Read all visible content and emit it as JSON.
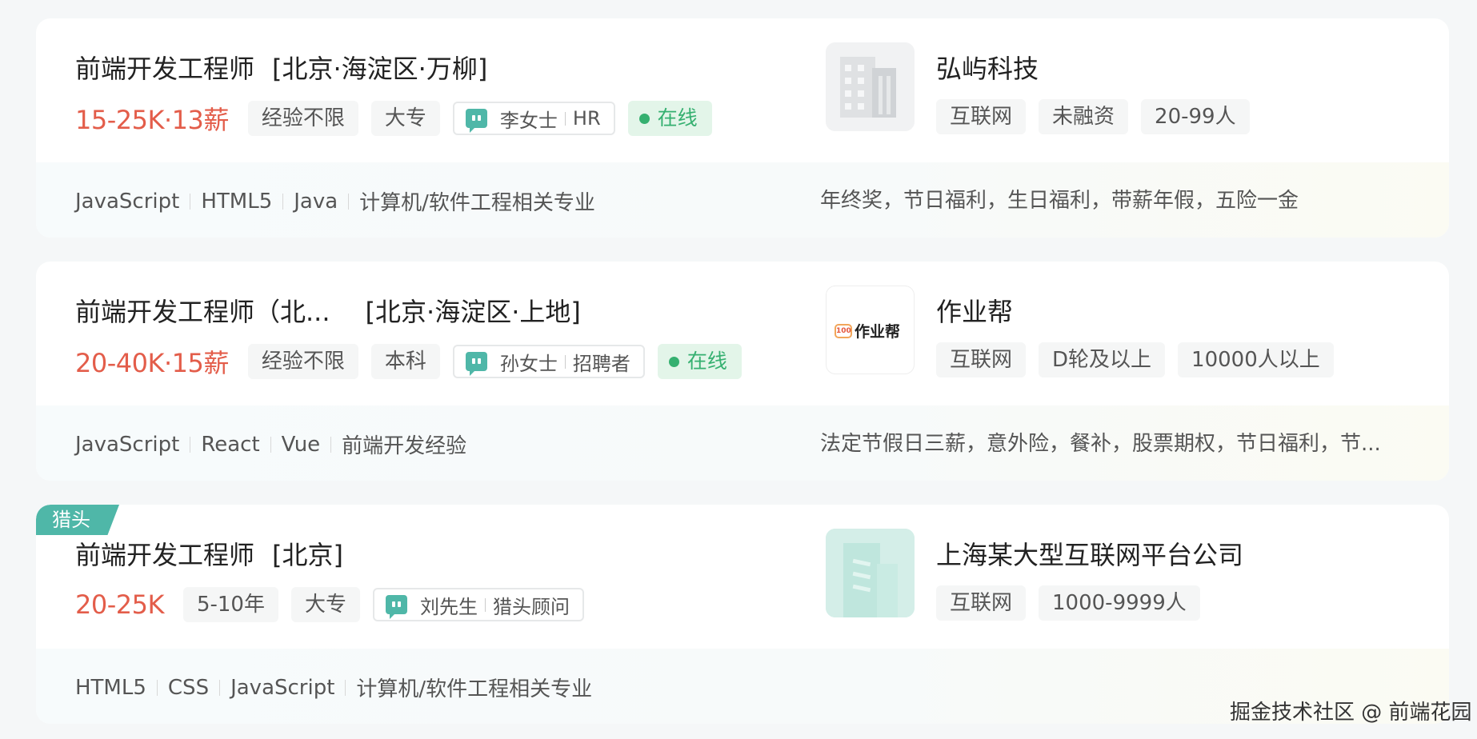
{
  "jobs": [
    {
      "title": "前端开发工程师",
      "location": "[北京·海淀区·万柳]",
      "salary": "15-25K·13薪",
      "tags": [
        "经验不限",
        "大专"
      ],
      "recruiter_name": "李女士",
      "recruiter_role": "HR",
      "online": "在线",
      "skills": [
        "JavaScript",
        "HTML5",
        "Java",
        "计算机/软件工程相关专业"
      ],
      "company": "弘屿科技",
      "company_tags": [
        "互联网",
        "未融资",
        "20-99人"
      ],
      "benefits": "年终奖，节日福利，生日福利，带薪年假，五险一金"
    },
    {
      "title": "前端开发工程师（北...",
      "location": "[北京·海淀区·上地]",
      "salary": "20-40K·15薪",
      "tags": [
        "经验不限",
        "本科"
      ],
      "recruiter_name": "孙女士",
      "recruiter_role": "招聘者",
      "online": "在线",
      "skills": [
        "JavaScript",
        "React",
        "Vue",
        "前端开发经验"
      ],
      "company": "作业帮",
      "company_logo_text": "作业帮",
      "company_logo_badge": "100",
      "company_tags": [
        "互联网",
        "D轮及以上",
        "10000人以上"
      ],
      "benefits": "法定节假日三薪，意外险，餐补，股票期权，节日福利，节..."
    },
    {
      "badge": "猎头",
      "title": "前端开发工程师",
      "location": "[北京]",
      "salary": "20-25K",
      "tags": [
        "5-10年",
        "大专"
      ],
      "recruiter_name": "刘先生",
      "recruiter_role": "猎头顾问",
      "skills": [
        "HTML5",
        "CSS",
        "JavaScript",
        "计算机/软件工程相关专业"
      ],
      "company": "上海某大型互联网平台公司",
      "company_tags": [
        "互联网",
        "1000-9999人"
      ]
    }
  ],
  "watermark": "掘金技术社区 @ 前端花园",
  "colors": {
    "salary": "#e35d4a",
    "accent": "#4fb7a8",
    "online_green": "#35b070"
  }
}
